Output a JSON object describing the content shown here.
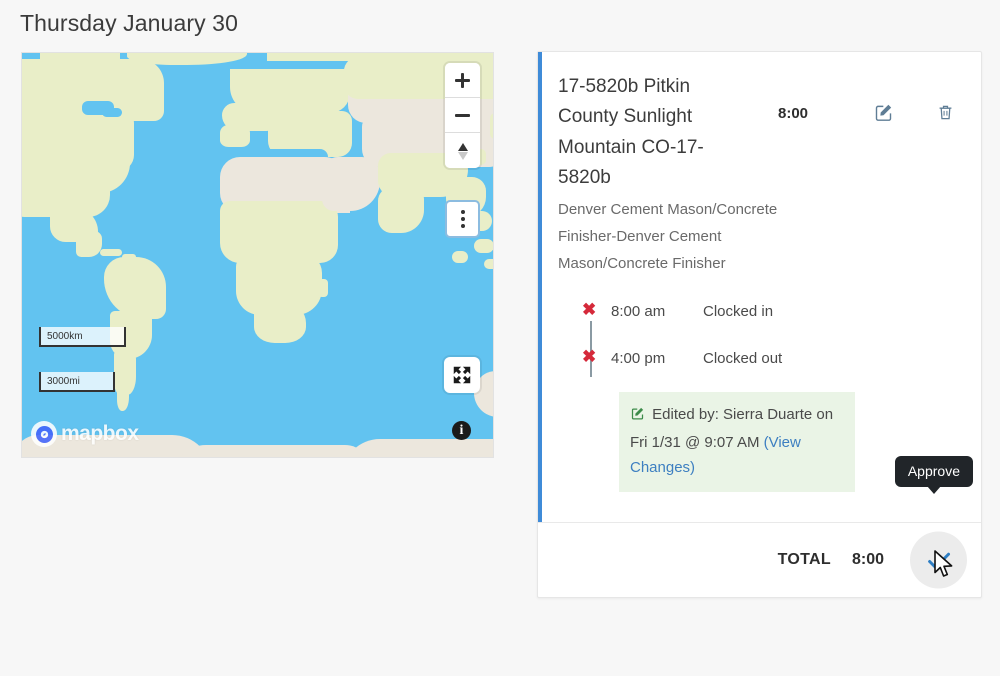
{
  "header": {
    "date": "Thursday January 30"
  },
  "map": {
    "provider": "mapbox",
    "zoom_in_label": "+",
    "zoom_out_label": "−",
    "compass_name": "compass",
    "menu_name": "more-options",
    "fullscreen_name": "fullscreen",
    "info_label": "i",
    "scale_km": "5000km",
    "scale_mi": "3000mi",
    "ocean_color": "#62c3f0",
    "land_color": "#e9eec8",
    "desert_color": "#ece7dd"
  },
  "card": {
    "accent_color": "#3f8bd8",
    "entry": {
      "title": "17-5820b Pitkin County Sunlight Mountain CO-17-5820b",
      "hours": "8:00",
      "subtitle": "Denver Cement Mason/Concrete Finisher-Denver Cement Mason/Concrete Finisher",
      "edit_icon_name": "edit-icon",
      "delete_icon_name": "trash-icon"
    },
    "timeline": [
      {
        "marker": "✖",
        "time": "8:00 am",
        "status": "Clocked in"
      },
      {
        "marker": "✖",
        "time": "4:00 pm",
        "status": "Clocked out"
      }
    ],
    "edit_note": {
      "text": "Edited by: Sierra Duarte on Fri 1/31 @ 9:07 AM",
      "link": "(View Changes)",
      "background": "#eaf4e6"
    },
    "total": {
      "label": "TOTAL",
      "value": "8:00"
    },
    "approve": {
      "tooltip": "Approve",
      "icon_name": "checkmark-icon",
      "color": "#2f7fc4"
    }
  }
}
